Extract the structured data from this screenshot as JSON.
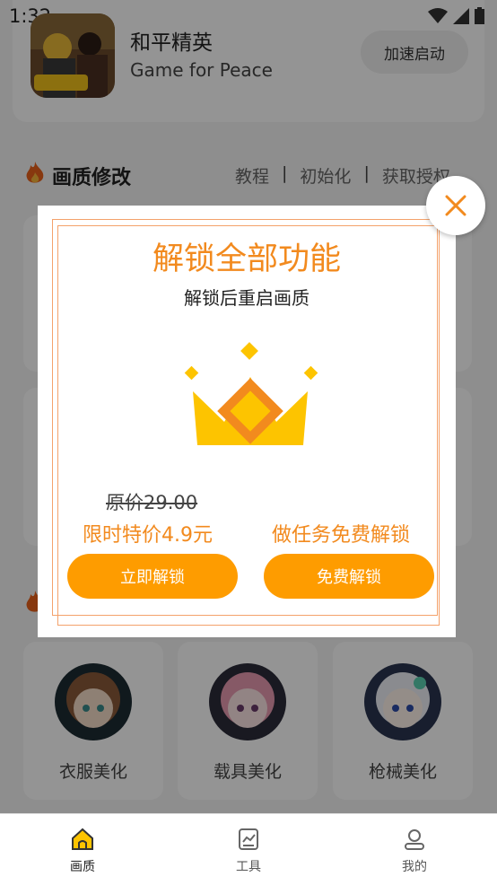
{
  "status_bar": {
    "time": "1:32"
  },
  "header": {
    "game_title": "和平精英",
    "game_subtitle": "Game for Peace",
    "boost_label": "加速启动",
    "game_icon": "game-icon-art"
  },
  "quality_section": {
    "title": "画质修改",
    "links": [
      "教程",
      "初始化",
      "获取授权"
    ]
  },
  "beautify_cards": [
    {
      "label": "衣服美化",
      "icon": "character-avatar"
    },
    {
      "label": "载具美化",
      "icon": "character-avatar"
    },
    {
      "label": "枪械美化",
      "icon": "character-avatar"
    }
  ],
  "modal": {
    "title": "解锁全部功能",
    "subtitle": "解锁后重启画质",
    "original_price": "原价29.00",
    "promo_price": "限时特价4.9元",
    "task_free_text": "做任务免费解锁",
    "unlock_button": "立即解锁",
    "free_button": "免费解锁",
    "accent_color": "#fe9c00"
  },
  "bottom_nav": [
    {
      "label": "画质",
      "icon": "home-icon",
      "active": true
    },
    {
      "label": "工具",
      "icon": "chart-icon",
      "active": false
    },
    {
      "label": "我的",
      "icon": "user-icon",
      "active": false
    }
  ]
}
